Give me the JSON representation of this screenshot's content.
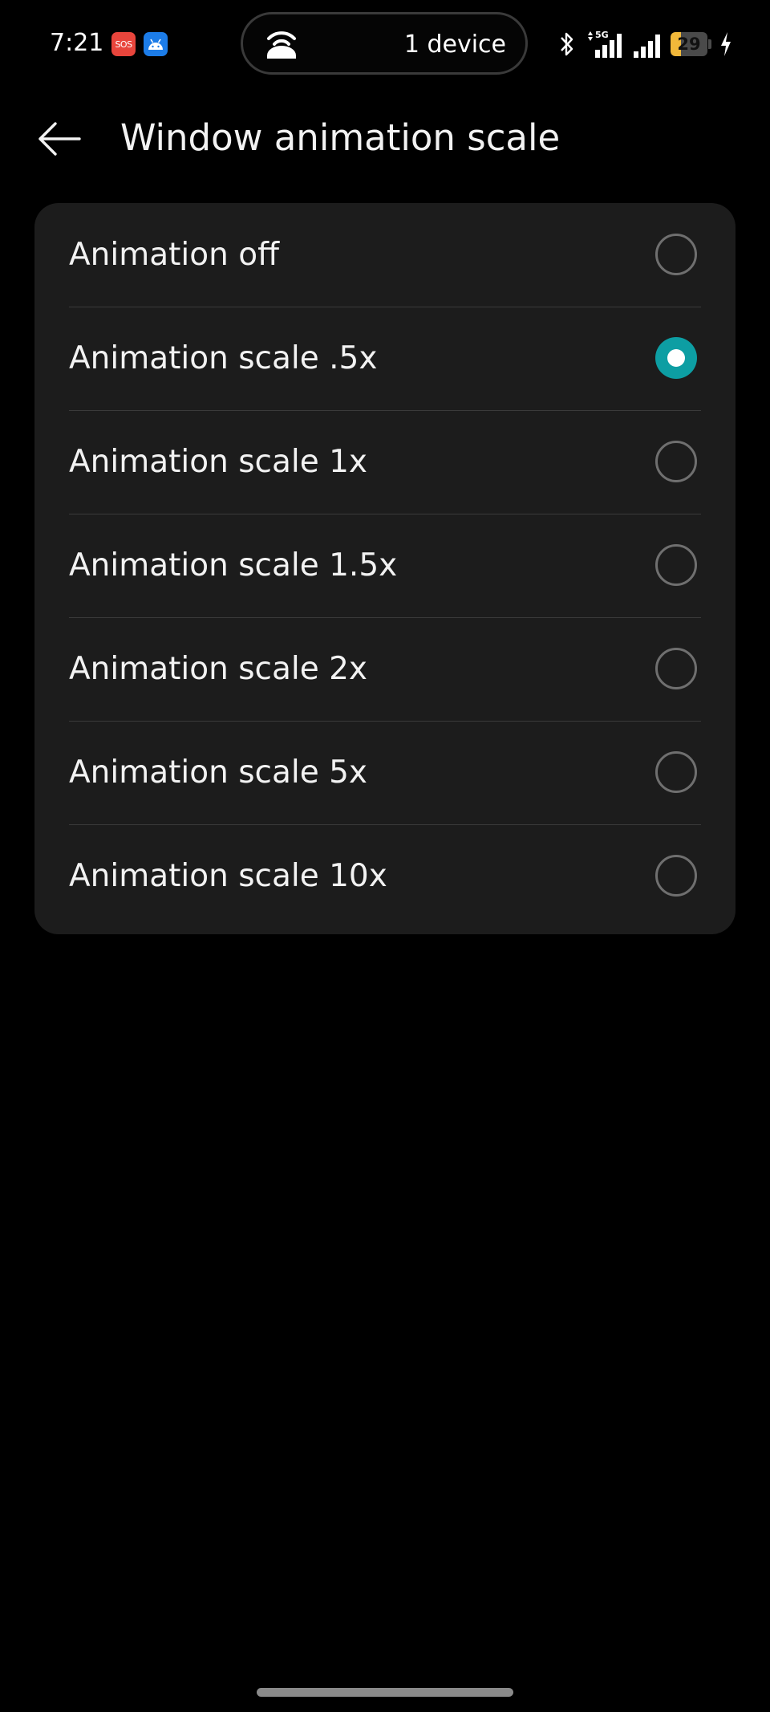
{
  "status_bar": {
    "time": "7:21",
    "notifications": [
      {
        "icon": "sos-icon",
        "label": "SOS",
        "color": "#e8453c"
      },
      {
        "icon": "android-icon",
        "color": "#1c7ce8"
      }
    ],
    "hotspot": {
      "icon": "hotspot-icon",
      "label": "1 device"
    },
    "network_type": "5G",
    "battery": {
      "level_text": "29",
      "level_percent": 29,
      "charging": true,
      "fill_color": "#f1b83a"
    }
  },
  "header": {
    "back_icon": "arrow-left-icon",
    "title": "Window animation scale"
  },
  "options": [
    {
      "label": "Animation off",
      "selected": false
    },
    {
      "label": "Animation scale .5x",
      "selected": true
    },
    {
      "label": "Animation scale 1x",
      "selected": false
    },
    {
      "label": "Animation scale 1.5x",
      "selected": false
    },
    {
      "label": "Animation scale 2x",
      "selected": false
    },
    {
      "label": "Animation scale 5x",
      "selected": false
    },
    {
      "label": "Animation scale 10x",
      "selected": false
    }
  ],
  "colors": {
    "background": "#000000",
    "card": "#1c1c1c",
    "accent": "#0d9ea3",
    "text": "#f2f2f2"
  }
}
